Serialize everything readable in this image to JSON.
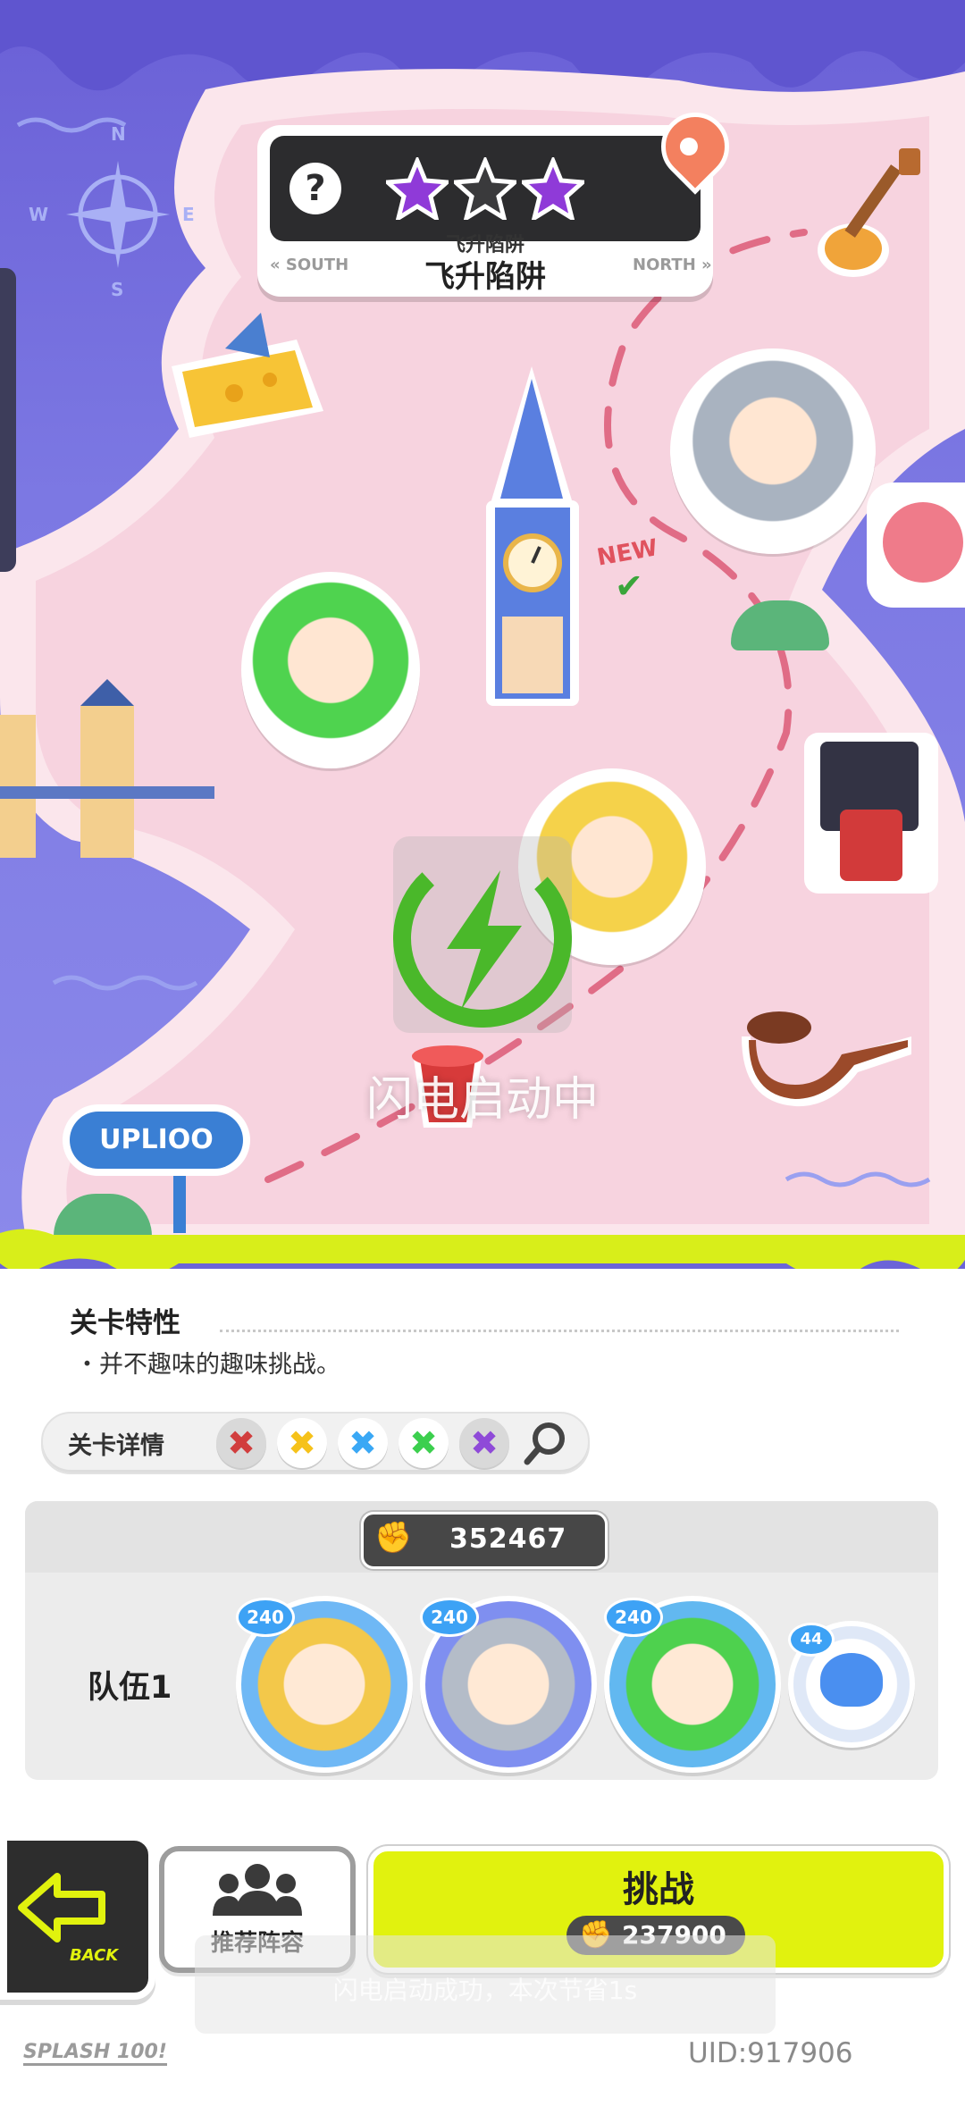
{
  "level": {
    "stars": [
      "filled",
      "empty",
      "filled"
    ],
    "name_small": "飞升陷阱",
    "name_big": "飞升陷阱",
    "dir_left": "SOUTH",
    "dir_right": "NORTH",
    "help_icon": "question-icon",
    "location_icon": "map-pin-icon"
  },
  "map": {
    "compass": {
      "n": "N",
      "e": "E",
      "s": "S",
      "w": "W"
    },
    "new_badge": "NEW",
    "sign_text": "UPLIOO"
  },
  "overlay": {
    "flash_text": "闪电启动中"
  },
  "stage": {
    "traits_title": "关卡特性",
    "traits_desc": "・并不趣味的趣味挑战。",
    "detail_label": "关卡详情",
    "gems": [
      {
        "color": "#d13d3d",
        "icon": "red-gem-icon"
      },
      {
        "color": "#f6c21a",
        "icon": "yellow-gem-icon"
      },
      {
        "color": "#3aa8f5",
        "icon": "blue-gem-icon"
      },
      {
        "color": "#3ccf4e",
        "icon": "green-gem-icon"
      },
      {
        "color": "#8f4ad8",
        "icon": "purple-gem-icon"
      }
    ]
  },
  "team": {
    "power": "352467",
    "label": "队伍1",
    "members": [
      {
        "level": "240",
        "icon": "blonde-hero-portrait"
      },
      {
        "level": "240",
        "icon": "silver-hair-hero-portrait"
      },
      {
        "level": "240",
        "icon": "green-hair-hero-portrait"
      }
    ],
    "pet": {
      "level": "44",
      "icon": "blue-pet-portrait"
    }
  },
  "buttons": {
    "back_label": "BACK",
    "recommend_label": "推荐阵容",
    "challenge_label": "挑战",
    "challenge_cost": "237900"
  },
  "toast": {
    "text": "闪电启动成功，本次节省1s"
  },
  "footer": {
    "logo": "SPLASH 100!",
    "uid": "UID:917906"
  },
  "colors": {
    "accent": "#e1f20e",
    "flash_green": "#4ab82a",
    "map_sea": "#7c78e3",
    "map_land": "#f7d3df"
  }
}
